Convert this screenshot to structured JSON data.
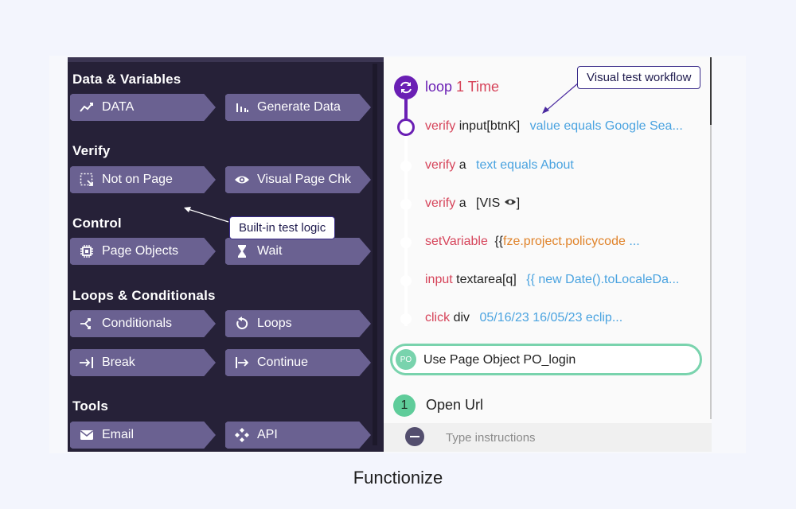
{
  "left_panel": {
    "sections": [
      {
        "title": "Data & Variables"
      },
      {
        "title": "Verify"
      },
      {
        "title": "Control"
      },
      {
        "title": "Loops & Conditionals"
      },
      {
        "title": "Tools"
      }
    ],
    "chips": [
      {
        "label": "DATA",
        "icon": "chart-line-icon"
      },
      {
        "label": "Generate Data",
        "icon": "bar-chart-icon"
      },
      {
        "label": "Not on Page",
        "icon": "dashed-select-icon"
      },
      {
        "label": "Visual Page Chk",
        "icon": "eye-icon"
      },
      {
        "label": "Page Objects",
        "icon": "chip-icon"
      },
      {
        "label": "Wait",
        "icon": "hourglass-icon"
      },
      {
        "label": "Conditionals",
        "icon": "branch-icon"
      },
      {
        "label": "Loops",
        "icon": "loop-arrow-icon"
      },
      {
        "label": "Break",
        "icon": "break-icon"
      },
      {
        "label": "Continue",
        "icon": "continue-icon"
      },
      {
        "label": "Email",
        "icon": "mail-icon"
      },
      {
        "label": "API",
        "icon": "api-icon"
      }
    ],
    "callout": "Built-in test logic"
  },
  "right_panel": {
    "loop": {
      "keyword": "loop",
      "count": "1 Time"
    },
    "callout": "Visual test workflow",
    "steps": [
      {
        "kw": "verify",
        "tag": "input[btnK]",
        "val": "value equals Google Sea..."
      },
      {
        "kw": "verify",
        "tag": "a",
        "val": "text equals About"
      },
      {
        "kw": "verify",
        "tag": "a",
        "val": "[VIS"
      },
      {
        "kw": "setVariable",
        "tag": "{{",
        "val": "fze.project.policycode",
        "ellipsis": "..."
      },
      {
        "kw": "input",
        "tag": "textarea[q]",
        "val": "{{ new Date().toLocaleDa..."
      },
      {
        "kw": "click",
        "tag": "div",
        "val": "05/16/23 16/05/23 eclip..."
      }
    ],
    "page_object": {
      "badge": "PO",
      "label": "Use Page Object PO_login"
    },
    "open_url": {
      "number": "1",
      "label": "Open Url"
    },
    "instructions_placeholder": "Type instructions",
    "colors": {
      "loop_purple": "#6a1fb4",
      "keyword_red": "#d6445a",
      "value_blue": "#4aa3e0",
      "po_green": "#79d3ad"
    }
  },
  "caption": "Functionize"
}
